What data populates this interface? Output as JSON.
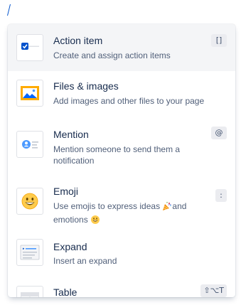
{
  "colors": {
    "accent": "#0052cc",
    "selected_bg": "#f4f5f7",
    "title": "#172b4d",
    "description": "#505f79",
    "shortcut_bg": "#ebecf0",
    "image_frame": "#ffab00"
  },
  "items": [
    {
      "icon": "action-item-checkbox-icon",
      "title": "Action item",
      "description": "Create and assign action items",
      "shortcut": "[]"
    },
    {
      "icon": "image-icon",
      "title": "Files & images",
      "description": "Add images and other files to your page",
      "shortcut": ""
    },
    {
      "icon": "mention-person-icon",
      "title": "Mention",
      "description": "Mention someone to send them a notification",
      "shortcut": "@"
    },
    {
      "icon": "smiley-emoji-icon",
      "title": "Emoji",
      "description_before": "Use emojis to express ideas ",
      "description_middle": "and emotions ",
      "inline_emojis": [
        "party-popper-emoji",
        "grinning-face-emoji"
      ],
      "shortcut": ":"
    },
    {
      "icon": "expand-icon",
      "title": "Expand",
      "description": "Insert an expand",
      "shortcut": ""
    },
    {
      "icon": "table-icon",
      "title": "Table",
      "description": "",
      "shortcut": "⇧⌥T"
    }
  ]
}
